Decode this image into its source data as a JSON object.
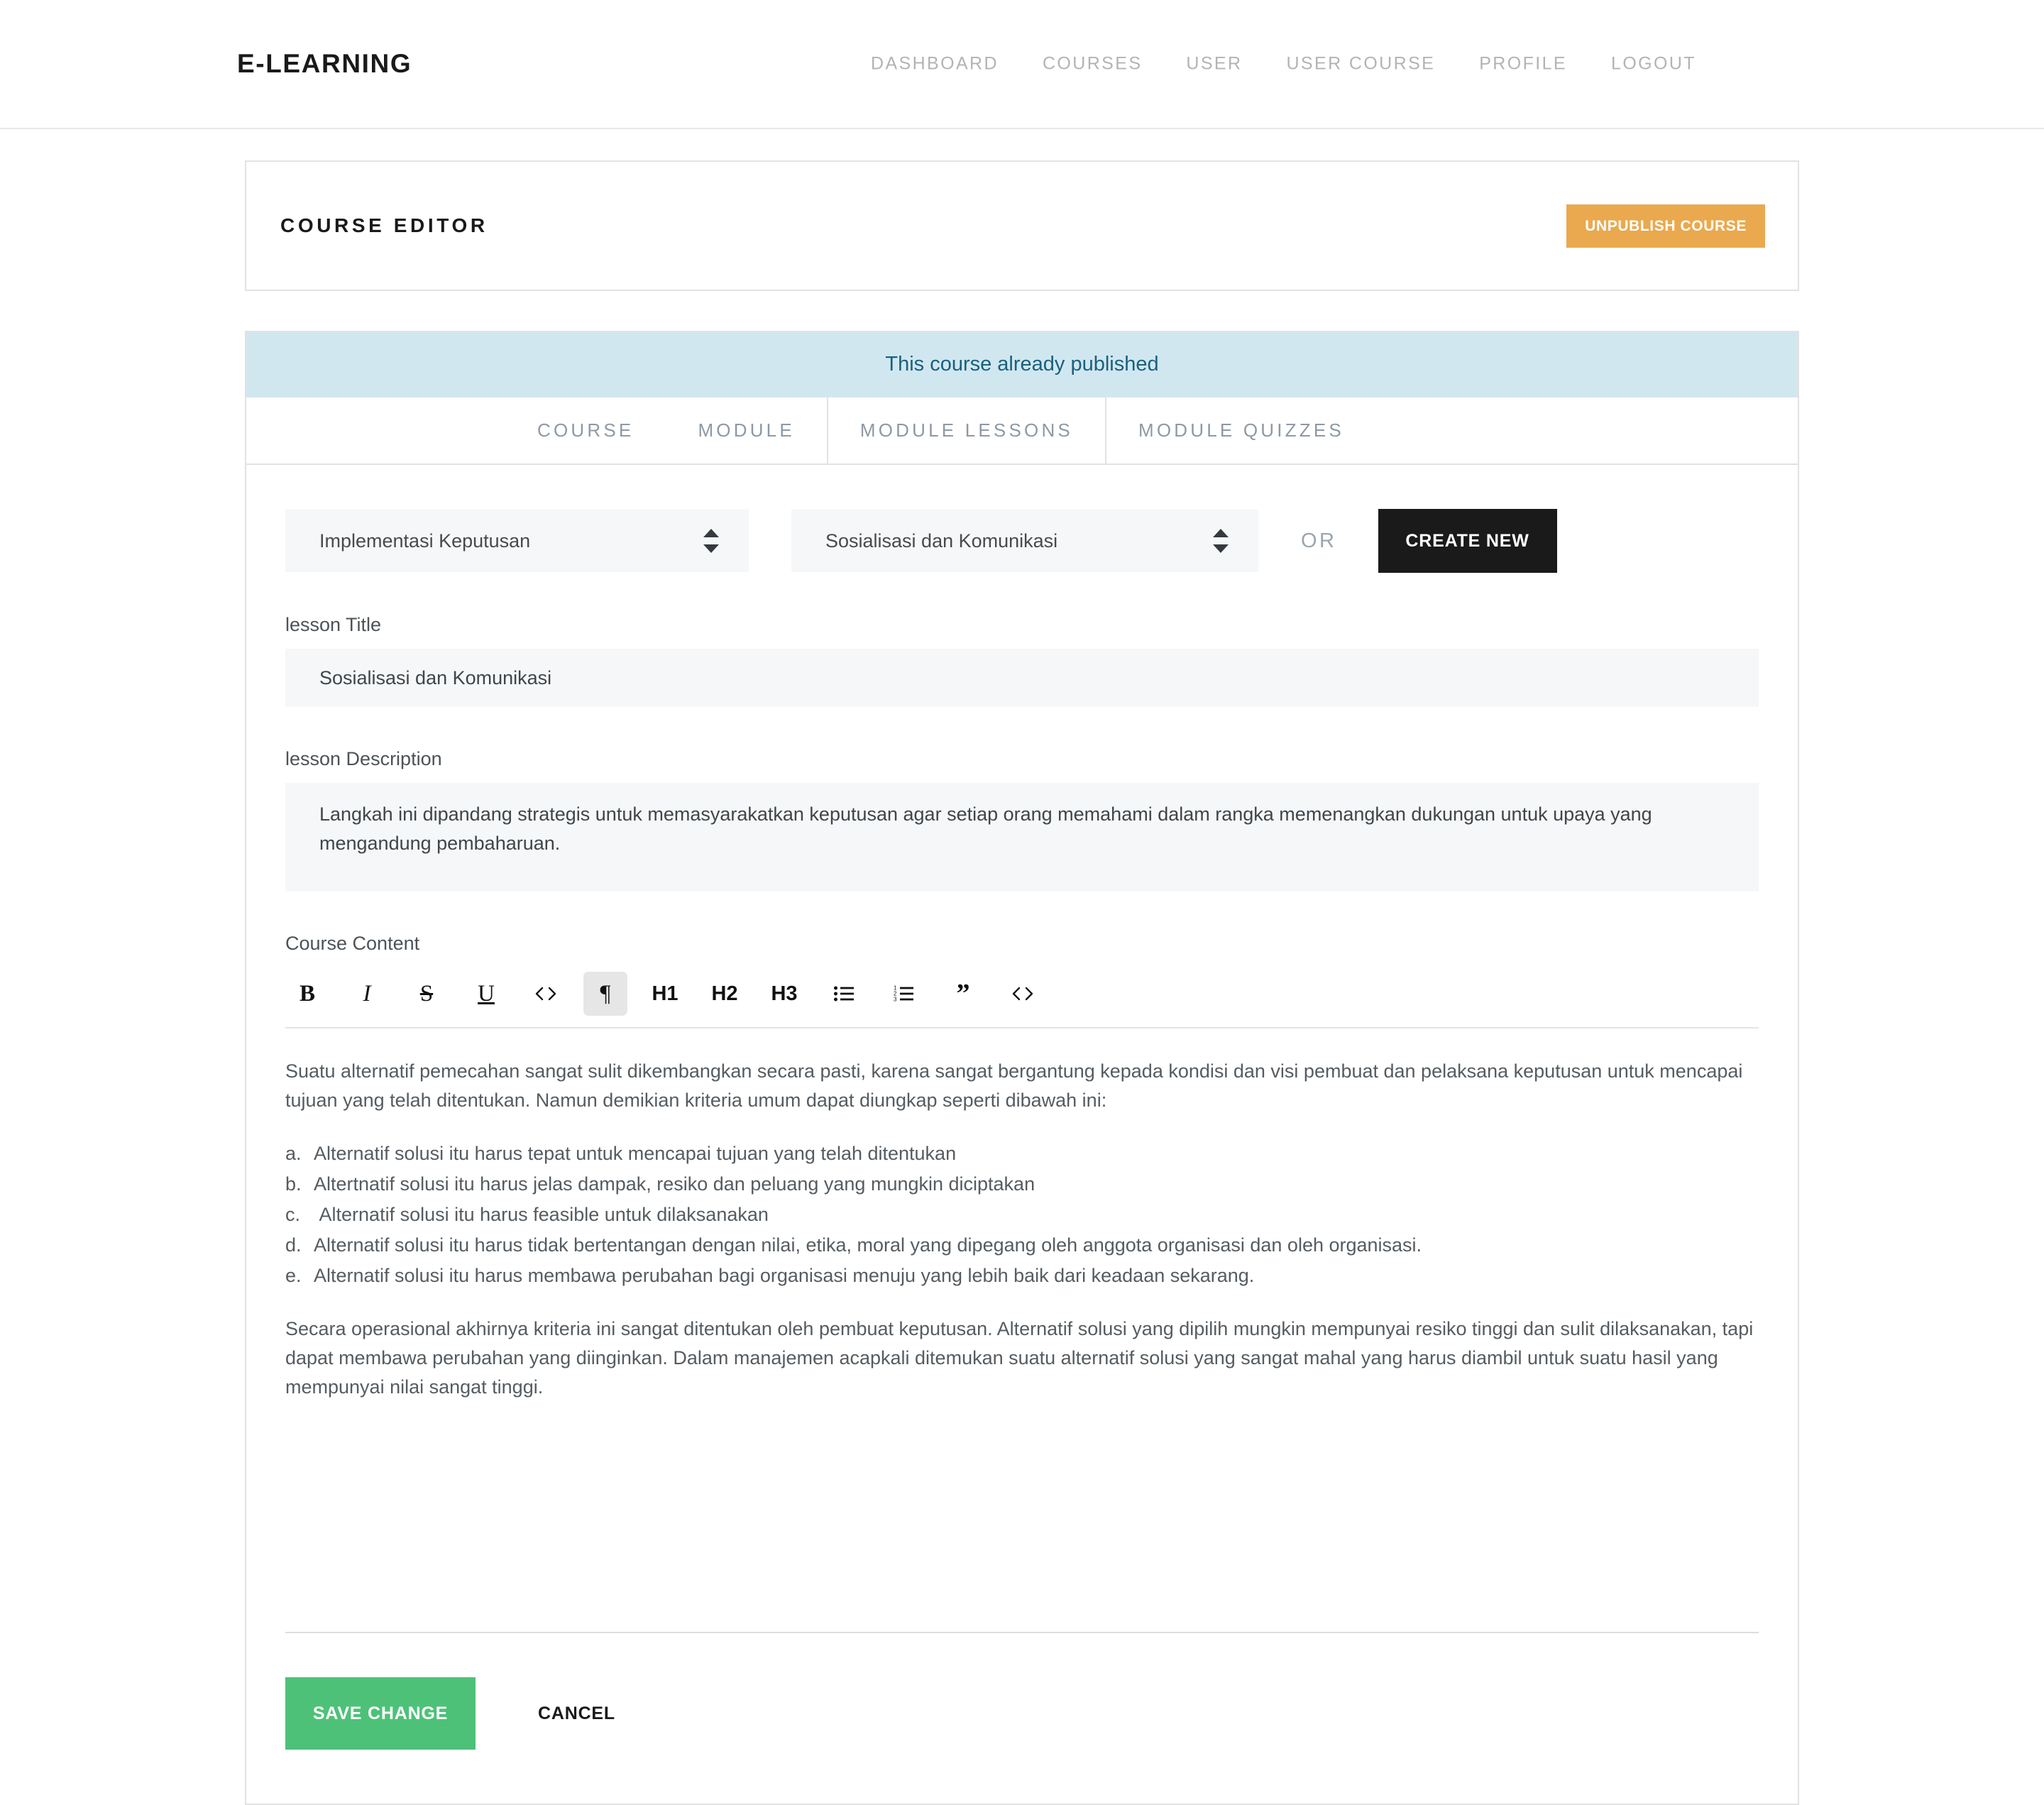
{
  "navbar": {
    "brand": "E-LEARNING",
    "links": [
      {
        "label": "DASHBOARD"
      },
      {
        "label": "COURSES"
      },
      {
        "label": "USER"
      },
      {
        "label": "USER COURSE"
      },
      {
        "label": "PROFILE"
      },
      {
        "label": "LOGOUT"
      }
    ]
  },
  "editor_header": {
    "title": "COURSE EDITOR",
    "unpublish_label": "UNPUBLISH COURSE",
    "unpublish_color": "#eaa94e"
  },
  "alert": {
    "message": "This course already published",
    "bg_color": "#d1e7f0",
    "text_color": "#19617d"
  },
  "tabs": [
    {
      "label": "COURSE",
      "active": false
    },
    {
      "label": "MODULE",
      "active": false
    },
    {
      "label": "MODULE LESSONS",
      "active": true
    },
    {
      "label": "MODULE QUIZZES",
      "active": false
    }
  ],
  "selectors": {
    "module_select": {
      "value": "Implementasi Keputusan",
      "icon": "chevron-updown-icon"
    },
    "lesson_select": {
      "value": "Sosialisasi dan Komunikasi",
      "icon": "chevron-updown-icon"
    },
    "or_label": "OR",
    "create_new_label": "CREATE NEW",
    "create_new_color": "#1a1a1a"
  },
  "form": {
    "title_label": "lesson Title",
    "title_value": "Sosialisasi dan Komunikasi",
    "title_placeholder": "",
    "description_label": "lesson Description",
    "description_value": "Langkah ini dipandang strategis untuk memasyarakatkan keputusan agar setiap orang memahami dalam rangka memenangkan dukungan untuk upaya yang mengandung pembaharuan.",
    "description_placeholder": "",
    "content_label": "Course Content"
  },
  "toolbar": [
    {
      "name": "bold-icon",
      "glyph": "B",
      "style": "serif",
      "active": false
    },
    {
      "name": "italic-icon",
      "glyph": "I",
      "style": "serif-i",
      "active": false
    },
    {
      "name": "strikethrough-icon",
      "glyph": "S",
      "style": "strike",
      "active": false
    },
    {
      "name": "underline-icon",
      "glyph": "U",
      "style": "under",
      "active": false
    },
    {
      "name": "inline-code-icon",
      "glyph": "<>",
      "style": "code",
      "active": false
    },
    {
      "name": "paragraph-icon",
      "glyph": "¶",
      "style": "serif",
      "active": true
    },
    {
      "name": "heading-1-icon",
      "glyph": "H1",
      "style": "heading",
      "active": false
    },
    {
      "name": "heading-2-icon",
      "glyph": "H2",
      "style": "heading",
      "active": false
    },
    {
      "name": "heading-3-icon",
      "glyph": "H3",
      "style": "heading",
      "active": false
    },
    {
      "name": "bullet-list-icon",
      "glyph": "",
      "style": "svg-ul",
      "active": false
    },
    {
      "name": "ordered-list-icon",
      "glyph": "",
      "style": "svg-ol",
      "active": false
    },
    {
      "name": "blockquote-icon",
      "glyph": "”",
      "style": "quote",
      "active": false
    },
    {
      "name": "code-block-icon",
      "glyph": "<>",
      "style": "code",
      "active": false
    }
  ],
  "content": {
    "intro": "Suatu alternatif pemecahan sangat sulit dikembangkan secara pasti, karena sangat bergantung kepada kondisi dan visi pembuat dan pelaksana keputusan untuk mencapai tujuan yang telah ditentukan. Namun demikian kriteria umum dapat diungkap seperti dibawah ini:",
    "list": [
      {
        "marker": "a.",
        "text": "Alternatif solusi itu harus tepat untuk mencapai tujuan yang telah ditentukan"
      },
      {
        "marker": "b.",
        "text": "Altertnatif solusi itu harus jelas dampak, resiko dan peluang yang mungkin diciptakan"
      },
      {
        "marker": "c.",
        "text": " Alternatif solusi itu harus feasible untuk dilaksanakan"
      },
      {
        "marker": "d.",
        "text": "Alternatif solusi itu harus tidak bertentangan dengan nilai, etika, moral yang dipegang oleh anggota organisasi dan oleh organisasi."
      },
      {
        "marker": "e.",
        "text": "Alternatif solusi itu harus membawa perubahan bagi organisasi menuju yang lebih baik dari keadaan sekarang."
      }
    ],
    "closing": "Secara operasional akhirnya kriteria ini sangat ditentukan oleh pembuat keputusan. Alternatif solusi yang dipilih mungkin mempunyai resiko tinggi dan sulit dilaksanakan, tapi dapat membawa perubahan yang diinginkan. Dalam manajemen acapkali ditemukan suatu alternatif solusi yang sangat mahal yang harus diambil untuk suatu hasil yang mempunyai nilai sangat tinggi."
  },
  "footer": {
    "save_label": "SAVE CHANGE",
    "save_color": "#4ec178",
    "cancel_label": "CANCEL"
  }
}
